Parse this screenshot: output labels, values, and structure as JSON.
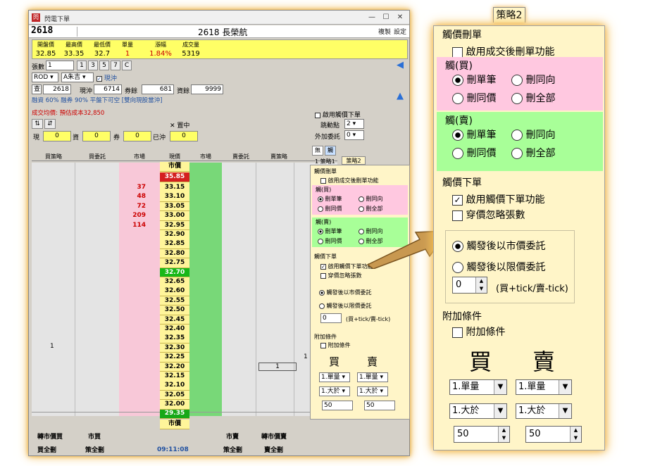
{
  "window": {
    "title": "閃電下單",
    "minimize": "—",
    "maximize": "☐",
    "close": "✕"
  },
  "stock": {
    "code": "2618",
    "name": "2618 長榮航",
    "copy": "複製",
    "settings": "設定"
  },
  "quote": {
    "headers": [
      "開盤價",
      "最高價",
      "最低價",
      "單量",
      "漲幅",
      "成交量"
    ],
    "values": [
      "32.85",
      "33.35",
      "32.7",
      "1",
      "1.84%",
      "5319"
    ]
  },
  "order": {
    "qty_label": "張數",
    "qty_value": "1",
    "qty_buttons": [
      "1",
      "3",
      "5",
      "7",
      "C"
    ],
    "type": "ROD",
    "account": "A朱吉",
    "daytrade_label": "現沖",
    "check_label": "查",
    "check_code": "2618",
    "daytrade2_label": "現沖",
    "daytrade2_value": "6714",
    "coupon_label": "券餘",
    "coupon_value": "681",
    "funds_label": "資餘",
    "funds_value": "9999",
    "margin_text": "融資 60% 融券 90% 平盤下可空 [雙向現股當沖]",
    "avg_label": "成交均價: 預估成本",
    "avg_value": "32,850"
  },
  "sidebar_checks": {
    "dynamic_label": "啟用觸價下單",
    "jump_label": "跳動點",
    "jump_value": "2",
    "extra_label": "外加委託",
    "extra_value": "0"
  },
  "position": {
    "curr_label": "現",
    "curr_value": "0",
    "funds_label": "資",
    "funds_value": "0",
    "coupon_label": "券",
    "coupon_value": "0",
    "done_label": "已沖",
    "done_value": "0",
    "concentrate": "✕ 置中"
  },
  "grid": {
    "headers": [
      "買策略",
      "買委託",
      "市場",
      "現價",
      "市場",
      "賣委託",
      "賣策略"
    ],
    "market_label": "市價",
    "top_price": "35.85",
    "bottom_price": "29.35",
    "prices": [
      "33.15",
      "33.10",
      "33.05",
      "33.00",
      "32.95",
      "32.90",
      "32.85",
      "32.80",
      "32.75",
      "32.70",
      "32.65",
      "32.60",
      "32.55",
      "32.50",
      "32.45",
      "32.40",
      "32.35",
      "32.30",
      "32.25",
      "32.20",
      "32.15",
      "32.10",
      "32.05",
      "32.00"
    ],
    "bid_volumes": [
      "37",
      "48",
      "72",
      "209",
      "114"
    ],
    "buy_strategy_mark": "1",
    "sell_strategy_marks": [
      "1",
      "1"
    ]
  },
  "bottom_bar": {
    "cancel_buy_market": "轉市價買",
    "market_buy": "市買",
    "cancel_all_buy": "買全刪",
    "cancel_all": "策全刪",
    "market_sell": "市賣",
    "cancel_sell_market": "轉市價賣",
    "cancel_all_sell": "賣全刪",
    "cancel_all_right": "策全刪",
    "time": "09:11:08"
  },
  "strategy_panel": {
    "tab_none": "無",
    "tab_touch": "觸",
    "tab1": "策略1",
    "tab2": "策略2",
    "cancel_section": "觸價刪單",
    "enable_cancel": "啟用成交後刪單功能",
    "buy_group": "觸(買)",
    "sell_group": "觸(賣)",
    "cancel_one": "刪單筆",
    "cancel_same_dir": "刪同向",
    "cancel_same_price": "刪同價",
    "cancel_all": "刪全部",
    "place_section": "觸價下單",
    "enable_place": "啟用觸價下單功能",
    "ignore_qty": "穿價忽略張數",
    "market_after": "觸發後以市價委託",
    "limit_after": "觸發後以限價委託",
    "tick_value": "0",
    "tick_hint": "(買+tick/賣-tick)",
    "extra_section": "附加條件",
    "extra_check": "附加條件",
    "buy_label": "買",
    "sell_label": "賣",
    "buy_mode": "1.單量",
    "sell_mode": "1.單量",
    "buy_cond": "1.大於",
    "sell_cond": "1.大於",
    "buy_value": "50",
    "sell_value": "50"
  },
  "colors": {
    "accent_orange": "#e8a830",
    "quote_yellow": "#ffff66",
    "pink": "#ffc8e0",
    "green": "#a8ff98",
    "panel_bg": "#fff5c8"
  }
}
